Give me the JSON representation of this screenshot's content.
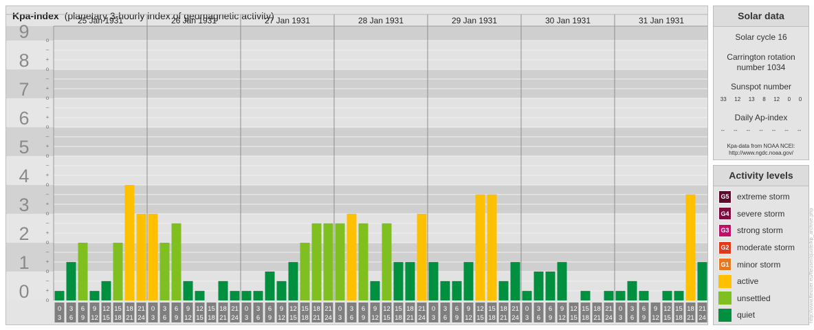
{
  "title": {
    "main": "Kpa-index",
    "sub": "(planetary 3-hourly index of geomagnetic activity)"
  },
  "chart_data": {
    "type": "bar",
    "title": "Kpa-index",
    "subtitle": "(planetary 3-hourly index of geomagnetic activity)",
    "ylim": [
      0,
      9
    ],
    "y_tick_labels": [
      "0",
      "1",
      "2",
      "3",
      "4",
      "5",
      "6",
      "7",
      "8",
      "9"
    ],
    "y_sub_tick_labels": [
      "o",
      "+",
      "–",
      "o"
    ],
    "days": [
      "25 Jan 1931",
      "26 Jan 1931",
      "27 Jan 1931",
      "28 Jan 1931",
      "29 Jan 1931",
      "30 Jan 1931",
      "31 Jan 1931"
    ],
    "interval_labels": [
      [
        "0",
        "3"
      ],
      [
        "3",
        "6"
      ],
      [
        "6",
        "9"
      ],
      [
        "9",
        "12"
      ],
      [
        "12",
        "15"
      ],
      [
        "15",
        "18"
      ],
      [
        "18",
        "21"
      ],
      [
        "21",
        "24"
      ]
    ],
    "values": [
      [
        0.33,
        1.33,
        2.0,
        0.33,
        0.67,
        2.0,
        4.0,
        3.0
      ],
      [
        3.0,
        2.0,
        2.67,
        0.67,
        0.33,
        0.0,
        0.67,
        0.33
      ],
      [
        0.33,
        0.33,
        1.0,
        0.67,
        1.33,
        2.0,
        2.67,
        2.67
      ],
      [
        2.67,
        3.0,
        2.67,
        0.67,
        2.67,
        1.33,
        1.33,
        3.0
      ],
      [
        1.33,
        0.67,
        0.67,
        1.33,
        3.67,
        3.67,
        0.67,
        1.33
      ],
      [
        0.33,
        1.0,
        1.0,
        1.33,
        0.0,
        0.33,
        0.0,
        0.33
      ],
      [
        0.33,
        0.67,
        0.33,
        0.0,
        0.33,
        0.33,
        3.67,
        1.33
      ]
    ],
    "levels": {
      "quiet": [
        0,
        2
      ],
      "unsettled": [
        2,
        3
      ],
      "active": [
        3,
        4
      ]
    },
    "colors": {
      "quiet": "#009040",
      "unsettled": "#7fbf20",
      "active": "#ffc000"
    }
  },
  "solar": {
    "title": "Solar data",
    "cycle": "Solar cycle 16",
    "carrington_line1": "Carrington rotation",
    "carrington_line2": "number 1034",
    "sunspot_label": "Sunspot number",
    "sunspot_values": [
      "33",
      "12",
      "13",
      "8",
      "12",
      "0",
      "0"
    ],
    "ap_label": "Daily Ap-index",
    "ap_values": [
      "--",
      "--",
      "--",
      "--",
      "--",
      "--",
      "--"
    ],
    "credit_line1": "Kpa-data from NOAA NCEI:",
    "credit_line2": "http://www.ngdc.noaa.gov/"
  },
  "activity": {
    "title": "Activity levels",
    "items": [
      {
        "code": "G5",
        "label": "extreme storm",
        "color": "#5a0a2a"
      },
      {
        "code": "G4",
        "label": "severe storm",
        "color": "#800a40"
      },
      {
        "code": "G3",
        "label": "strong storm",
        "color": "#c0106a"
      },
      {
        "code": "G2",
        "label": "moderate storm",
        "color": "#e03a1a"
      },
      {
        "code": "G1",
        "label": "minor storm",
        "color": "#e87820"
      },
      {
        "code": "",
        "label": "active",
        "color": "#ffc000"
      },
      {
        "code": "",
        "label": "unsettled",
        "color": "#7fbf20"
      },
      {
        "code": "",
        "label": "quiet",
        "color": "#009040"
      }
    ]
  },
  "side_credit": "http://www.fleuser.eu/fleuser/quote/kp_archive.php"
}
